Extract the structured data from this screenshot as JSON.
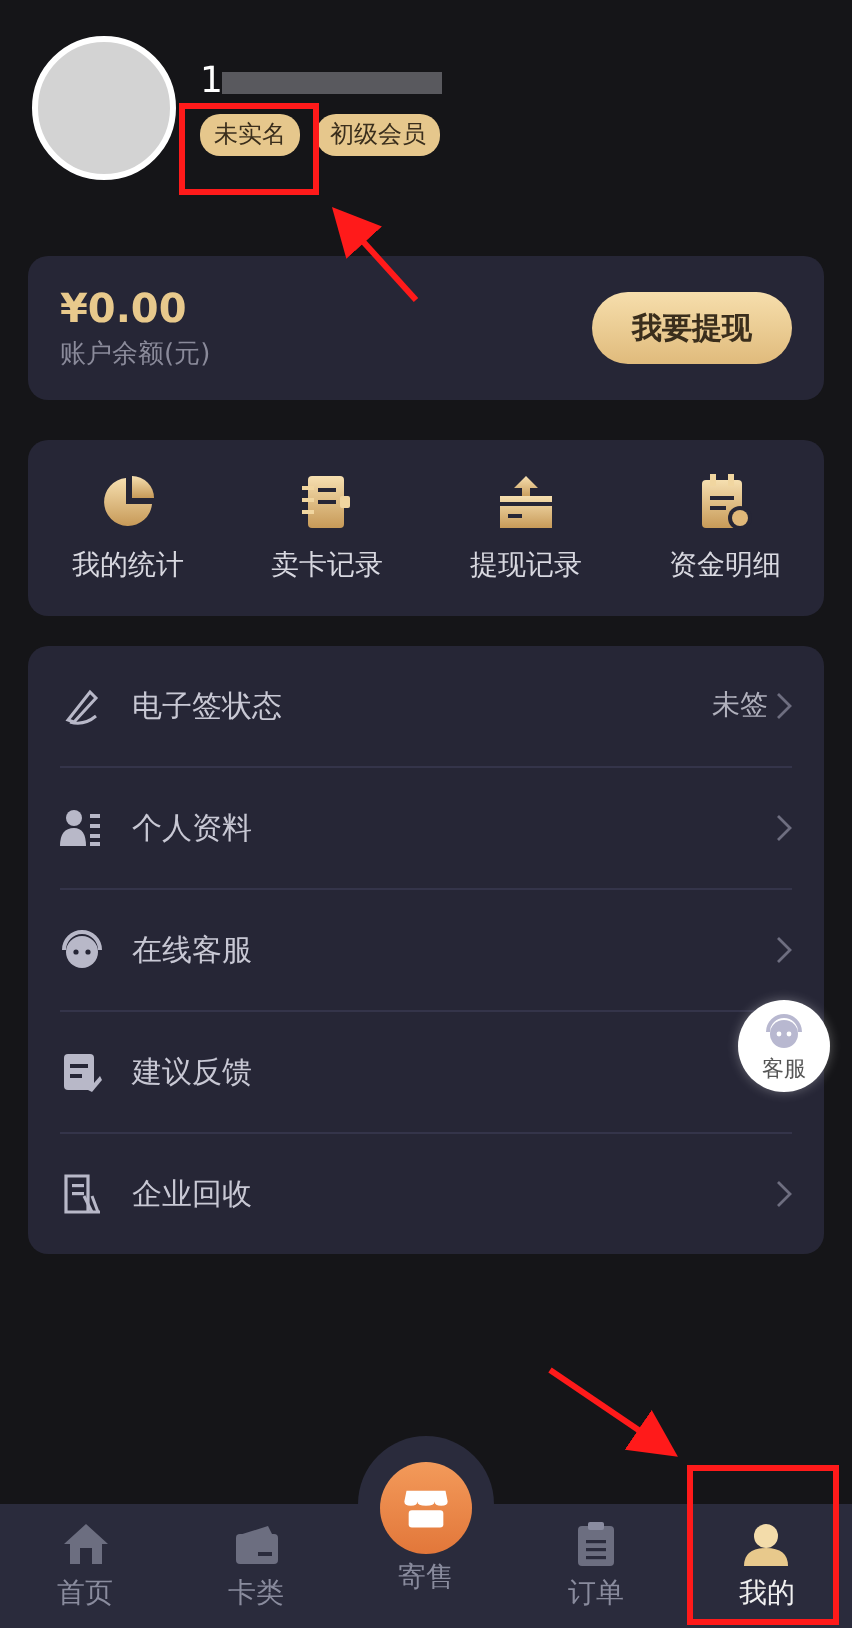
{
  "profile": {
    "phone": "1",
    "badges": [
      "未实名",
      "初级会员"
    ]
  },
  "balance": {
    "amount": "¥0.00",
    "label": "账户余额(元)",
    "button": "我要提现"
  },
  "shortcuts": [
    {
      "label": "我的统计"
    },
    {
      "label": "卖卡记录"
    },
    {
      "label": "提现记录"
    },
    {
      "label": "资金明细"
    }
  ],
  "menu": [
    {
      "label": "电子签状态",
      "value": "未签"
    },
    {
      "label": "个人资料"
    },
    {
      "label": "在线客服"
    },
    {
      "label": "建议反馈"
    },
    {
      "label": "企业回收"
    }
  ],
  "float_button": {
    "label": "客服"
  },
  "tabs": [
    {
      "label": "首页",
      "selected": false
    },
    {
      "label": "卡类",
      "selected": false
    },
    {
      "label": "寄售",
      "selected": false,
      "kind": "center"
    },
    {
      "label": "订单",
      "selected": false
    },
    {
      "label": "我的",
      "selected": true
    }
  ]
}
